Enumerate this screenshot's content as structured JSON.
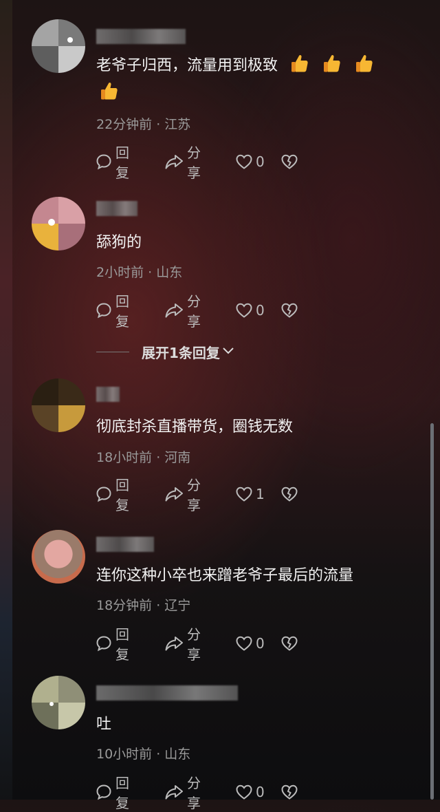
{
  "actions": {
    "reply_label": "回复",
    "share_label": "分享"
  },
  "comments": [
    {
      "text": "老爷子归西，流量用到极致",
      "emoji_name": "thumbs-up-icon",
      "emoji_count": 4,
      "meta": "22分钟前 · 江苏",
      "likes": "0"
    },
    {
      "name": "",
      "text": "舔狗的",
      "meta": "2小时前 · 山东",
      "likes": "0"
    },
    {
      "text": "彻底封杀直播带货，圈钱无数",
      "meta": "18小时前 · 河南",
      "likes": "1"
    },
    {
      "text": "连你这种小卒也来蹭老爷子最后的流量",
      "meta": "18分钟前 · 辽宁",
      "likes": "0"
    },
    {
      "text": "吐",
      "meta": "10小时前 · 山东",
      "likes": "0"
    }
  ],
  "expand_replies": {
    "label": "展开1条回复"
  },
  "colors": {
    "text": "#f2f2f2",
    "meta": "#9a9a9a",
    "action": "#bcbcbc"
  }
}
